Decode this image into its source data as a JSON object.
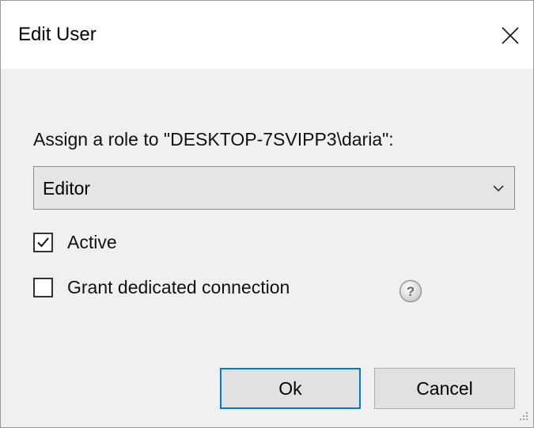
{
  "window": {
    "title": "Edit User",
    "close_icon": "close-icon"
  },
  "form": {
    "prompt": "Assign a role to \"DESKTOP-7SVIPP3\\daria\":",
    "role_select": {
      "selected": "Editor",
      "icon": "chevron-down-icon"
    },
    "active": {
      "label": "Active",
      "checked": true
    },
    "dedicated_connection": {
      "label": "Grant dedicated connection",
      "checked": false,
      "help_icon": "question-mark-icon"
    }
  },
  "buttons": {
    "ok_label": "Ok",
    "cancel_label": "Cancel"
  },
  "colors": {
    "accent": "#0078d7",
    "dialog_bg": "#f0f0f0",
    "titlebar_bg": "#ffffff",
    "select_bg": "#e5e5e5",
    "button_bg": "#e1e1e1"
  }
}
